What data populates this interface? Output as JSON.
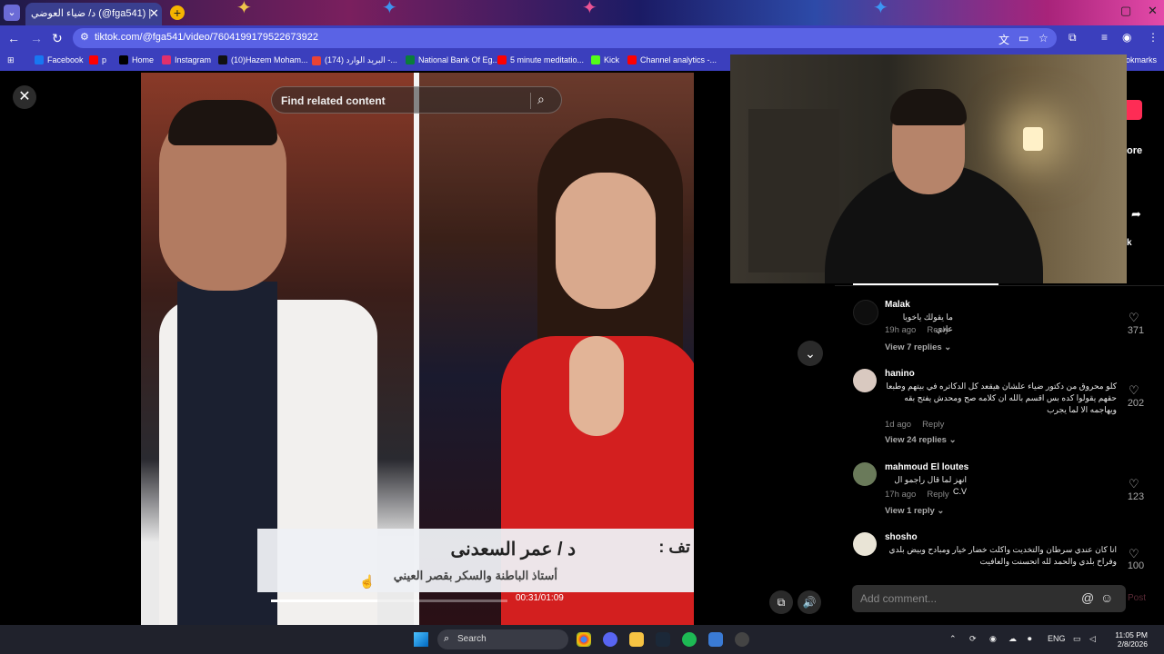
{
  "browser": {
    "tab_title": "د/ ضياء العوضي (@fga541) |",
    "url": "tiktok.com/@fga541/video/7604199179522673922",
    "bookmarks": [
      {
        "label": "Facebook",
        "color": "#1877f2"
      },
      {
        "label": "p",
        "color": "#ff0000"
      },
      {
        "label": "Home",
        "color": "#000000"
      },
      {
        "label": "Instagram",
        "color": "#e1306c"
      },
      {
        "label": "(10)Hazem Moham...",
        "color": "#111111"
      },
      {
        "label": "(174) البريد الوارد -...",
        "color": "#ea4335"
      },
      {
        "label": "National Bank Of Eg...",
        "color": "#0a7d3b"
      },
      {
        "label": "5 minute meditatio...",
        "color": "#ff0000"
      },
      {
        "label": "Kick",
        "color": "#53fc18"
      },
      {
        "label": "Channel analytics -...",
        "color": "#ff0000"
      }
    ],
    "bookmarks_end": "ookmarks"
  },
  "video": {
    "search_placeholder": "Find related content",
    "caption_name": "د / عمر السعدنى",
    "caption_title": "أستاذ الباطنة والسكر بقصر العيني",
    "caption_prefix": "تف :",
    "time": "00:31/01:09",
    "progress": 0.449
  },
  "side_fragments": {
    "more": "ore",
    "k": "k"
  },
  "comments": [
    {
      "user": "Malak",
      "text": "ما يقولك ياخويا عادي",
      "time": "19h ago",
      "reply": "Reply",
      "replies": "View 7 replies",
      "likes": "371"
    },
    {
      "user": "hanino",
      "text": "كلو محروق من دكتور ضياء علشان هيقعد كل الدكاتره في بيتهم وطبعا حقهم يقولوا كده بس اقسم بالله ان كلامه صح ومحدش يفتح بقه ويهاجمه الا لما يجرب",
      "time": "1d ago",
      "reply": "Reply",
      "replies": "View 24 replies",
      "likes": "202"
    },
    {
      "user": "mahmoud El loutes",
      "text": "انهز لما قال راجمو ال C.V",
      "time": "17h ago",
      "reply": "Reply",
      "replies": "View 1 reply",
      "likes": "123"
    },
    {
      "user": "shosho",
      "text": "انا كان عندي سرطان والتخديت واكلت خضار خيار ومبادح وبيض بلدي وفراخ بلدي والحمد لله اتحسنت والعافيت",
      "likes": "100"
    }
  ],
  "comment_input": {
    "placeholder": "Add comment...",
    "post": "Post"
  },
  "taskbar": {
    "search": "Search",
    "lang": "ENG",
    "time": "11:05 PM",
    "date": "2/8/2026"
  }
}
